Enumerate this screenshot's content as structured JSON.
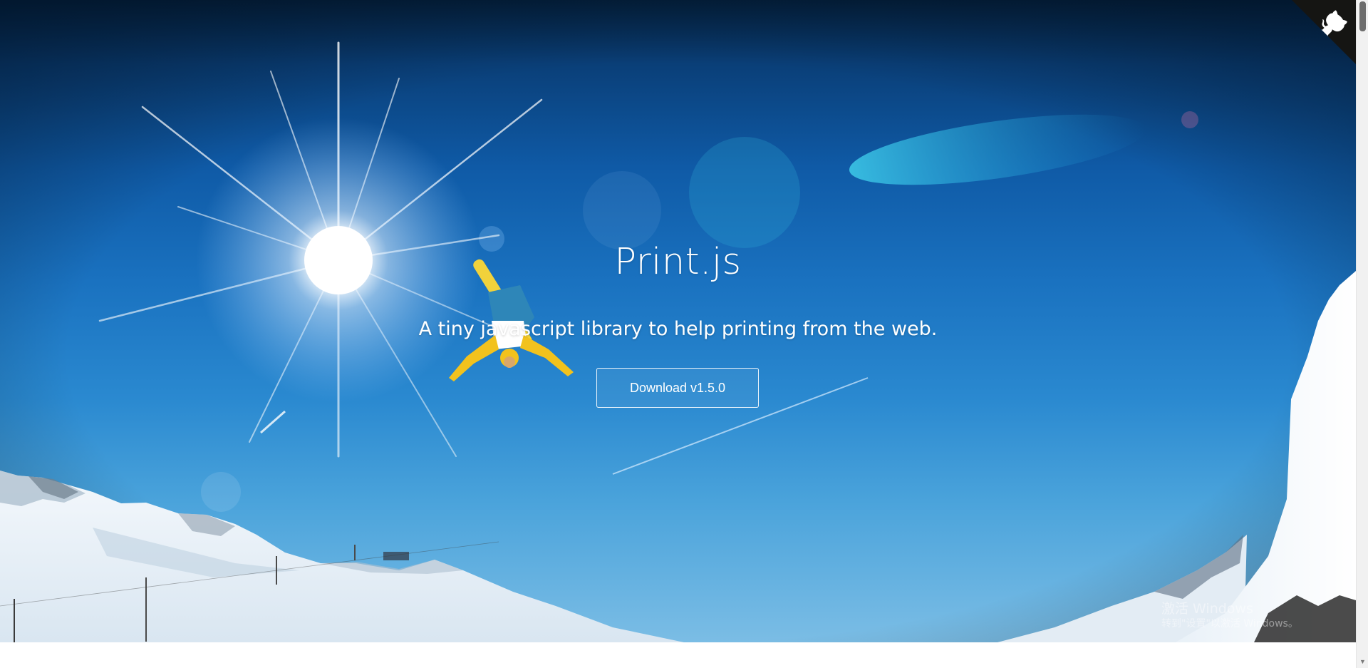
{
  "hero": {
    "title": "Print.js",
    "subtitle": "A tiny javascript library to help printing from the web.",
    "download_label": "Download v1.5.0",
    "background_description_icon": "snowboarder-photo"
  },
  "github_corner": {
    "icon": "octocat-icon",
    "background_color": "#151513",
    "foreground_color": "#ffffff"
  },
  "watermark": {
    "line1": "激活 Windows",
    "line2": "转到\"设置\"以激活 Windows。"
  },
  "colors": {
    "sky_top": "#04213f",
    "sky_mid": "#1a72c0",
    "sky_bottom": "#7bbde5",
    "button_border": "#ffffff",
    "text": "#ffffff"
  }
}
